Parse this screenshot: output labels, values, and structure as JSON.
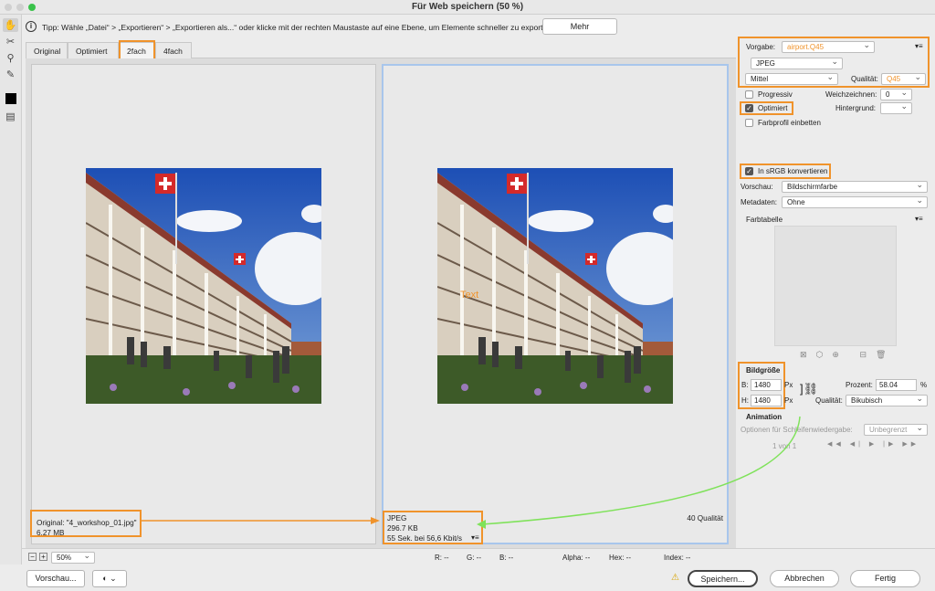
{
  "window": {
    "title": "Für Web speichern (50 %)"
  },
  "tip": {
    "text": "Tipp: Wähle „Datei“ > „Exportieren“ > „Exportieren als...“ oder klicke mit der rechten Maustaste auf eine Ebene, um Elemente schneller zu exportieren",
    "more_button": "Mehr"
  },
  "tabs": [
    "Original",
    "Optimiert",
    "2fach",
    "4fach"
  ],
  "left_info": {
    "line1": "Original: \"4_workshop_01.jpg\"",
    "line2": "6.27 MB"
  },
  "right_info": {
    "format": "JPEG",
    "size": "296.7 KB",
    "time": "55 Sek. bei 56,6 Kbit/s",
    "quality": "40 Qualität",
    "overlay_text": "Text"
  },
  "settings": {
    "preset_label": "Vorgabe:",
    "preset_value": "airport.Q45",
    "format": "JPEG",
    "compression": "Mittel",
    "quality_label": "Qualität:",
    "quality_value": "Q45",
    "progressive_label": "Progressiv",
    "blur_label": "Weichzeichnen:",
    "blur_value": "0",
    "optimized_label": "Optimiert",
    "matte_label": "Hintergrund:",
    "embed_profile_label": "Farbprofil einbetten",
    "srgb_label": "In sRGB konvertieren",
    "preview_label": "Vorschau:",
    "preview_value": "Bildschirmfarbe",
    "metadata_label": "Metadaten:",
    "metadata_value": "Ohne",
    "color_table_label": "Farbtabelle"
  },
  "image_size": {
    "title": "Bildgröße",
    "w_label": "B:",
    "w_value": "1480",
    "w_unit": "Px",
    "h_label": "H:",
    "h_value": "1480",
    "h_unit": "Px",
    "percent_label": "Prozent:",
    "percent_value": "58.04",
    "percent_unit": "%",
    "quality_label": "Qualität:",
    "quality_value": "Bikubisch"
  },
  "animation": {
    "title": "Animation",
    "loop_label": "Optionen für Schleifenwiedergabe:",
    "loop_value": "Unbegrenzt",
    "frame_counter": "1 von 1"
  },
  "status": {
    "zoom": "50%",
    "r": "R: --",
    "g": "G: --",
    "b": "B: --",
    "alpha": "Alpha: --",
    "hex": "Hex: --",
    "index": "Index: --"
  },
  "buttons": {
    "preview": "Vorschau...",
    "save": "Speichern...",
    "cancel": "Abbrechen",
    "done": "Fertig"
  },
  "colors": {
    "highlight": "#f0932b",
    "arrow": "#7fe25a",
    "text_overlay": "#f0932b"
  }
}
